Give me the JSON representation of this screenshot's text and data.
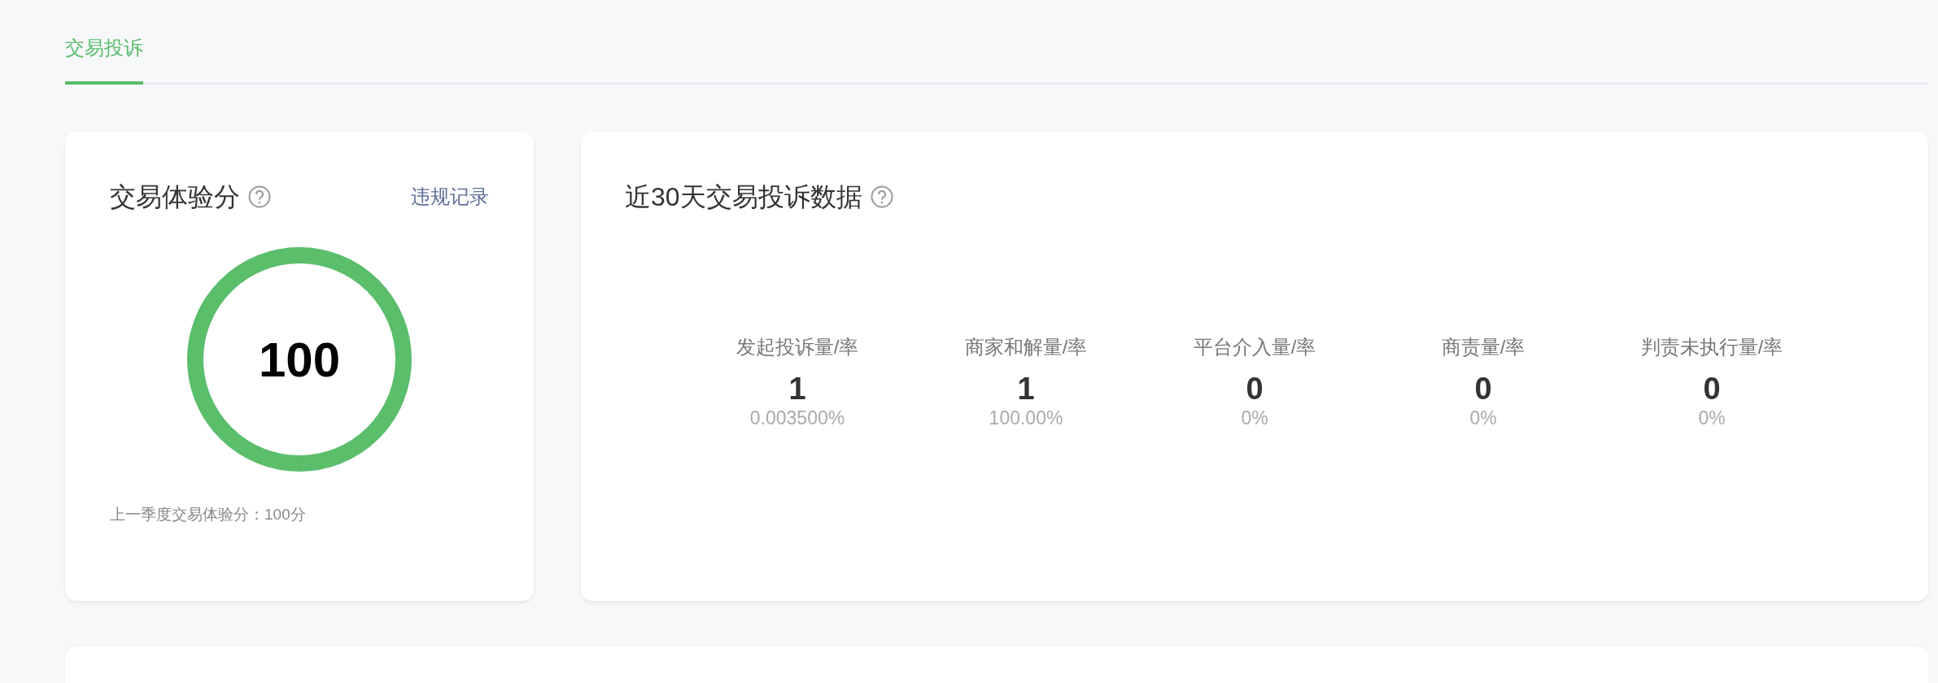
{
  "tabs": [
    {
      "label": "交易投诉",
      "selected": true
    }
  ],
  "score_card": {
    "title": "交易体验分",
    "link": "违规记录",
    "score": "100",
    "level": 1,
    "previous": "上一季度交易体验分：100分"
  },
  "complaint_card": {
    "title": "近30天交易投诉数据",
    "stats": [
      {
        "label": "发起投诉量/率",
        "count": "1",
        "rate": "0.003500%"
      },
      {
        "label": "商家和解量/率",
        "count": "1",
        "rate": "100.00%"
      },
      {
        "label": "平台介入量/率",
        "count": "0",
        "rate": "0%"
      },
      {
        "label": "商责量/率",
        "count": "0",
        "rate": "0%"
      },
      {
        "label": "判责未执行量/率",
        "count": "0",
        "rate": "0%"
      }
    ]
  }
}
